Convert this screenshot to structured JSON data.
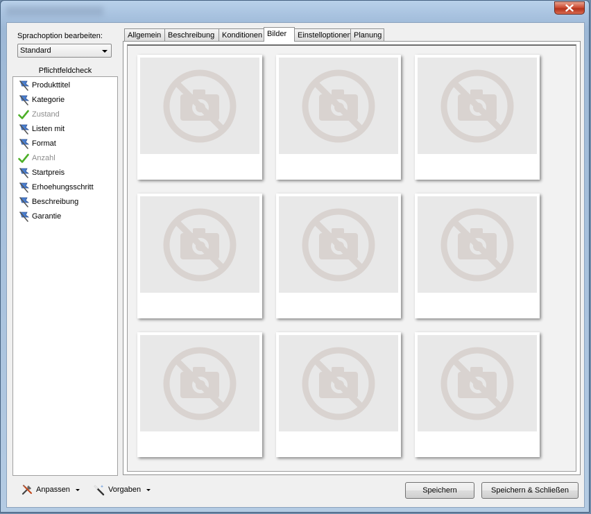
{
  "window": {
    "close_label": "✕"
  },
  "sidebar": {
    "language_label": "Sprachoption bearbeiten:",
    "language_selected": "Standard",
    "checklist_title": "Pflichtfeldcheck",
    "items": [
      {
        "label": "Produkttitel",
        "status": "flag"
      },
      {
        "label": "Kategorie",
        "status": "flag"
      },
      {
        "label": "Zustand",
        "status": "check"
      },
      {
        "label": "Listen mit",
        "status": "flag"
      },
      {
        "label": "Format",
        "status": "flag"
      },
      {
        "label": "Anzahl",
        "status": "check"
      },
      {
        "label": "Startpreis",
        "status": "flag"
      },
      {
        "label": "Erhoehungsschritt",
        "status": "flag"
      },
      {
        "label": "Beschreibung",
        "status": "flag"
      },
      {
        "label": "Garantie",
        "status": "flag"
      }
    ]
  },
  "tabs": [
    {
      "label": "Allgemein",
      "active": false
    },
    {
      "label": "Beschreibung",
      "active": false
    },
    {
      "label": "Konditionen",
      "active": false
    },
    {
      "label": "Bilder",
      "active": true
    },
    {
      "label": "Einstelloptionen",
      "active": false
    },
    {
      "label": "Planung",
      "active": false
    }
  ],
  "gallery": {
    "slot_count": 9,
    "placeholder_icon": "no-camera-icon"
  },
  "footer": {
    "customize_label": "Anpassen",
    "defaults_label": "Vorgaben",
    "save_label": "Speichern",
    "save_close_label": "Speichern & Schließen"
  },
  "colors": {
    "flag": "#4a7fd0",
    "check": "#4caf27",
    "placeholder": "#d9d3d0"
  }
}
